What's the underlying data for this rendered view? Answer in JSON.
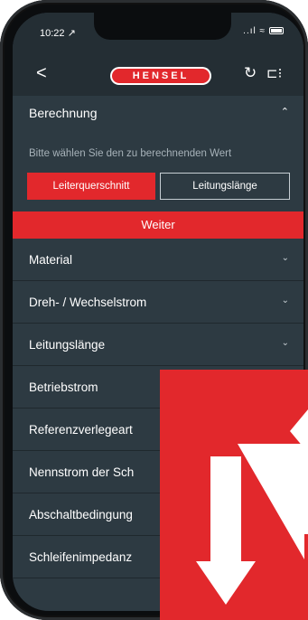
{
  "status_bar": {
    "time": "10:22 ↗",
    "signal": "..ıl ≈"
  },
  "header": {
    "back_glyph": "<",
    "logo_text": "HENSEL",
    "reset_glyph": "↻",
    "plug_glyph": "⊏⁝"
  },
  "section": {
    "title": "Berechnung",
    "hint": "Bitte wählen Sie den zu berechnenden Wert",
    "options": [
      "Leiterquerschnitt",
      "Leitungslänge"
    ],
    "selected_option": "Leiterquerschnitt",
    "continue_label": "Weiter"
  },
  "rows": [
    {
      "label": "Material"
    },
    {
      "label": "Dreh- / Wechselstrom"
    },
    {
      "label": "Leitungslänge"
    },
    {
      "label": "Betriebstrom"
    },
    {
      "label": "Referenzverlegeart"
    },
    {
      "label": "Nennstrom der Sch"
    },
    {
      "label": "Abschaltbedingung"
    },
    {
      "label": "Schleifenimpedanz"
    }
  ],
  "colors": {
    "accent_red": "#e2282c",
    "background": "#2d3a42",
    "header": "#242e34"
  },
  "icons": {
    "back": "chevron-left-icon",
    "reset": "refresh-icon",
    "plug": "plug-icon",
    "expanded": "chevron-up-icon",
    "collapsed": "chevron-down-icon"
  }
}
